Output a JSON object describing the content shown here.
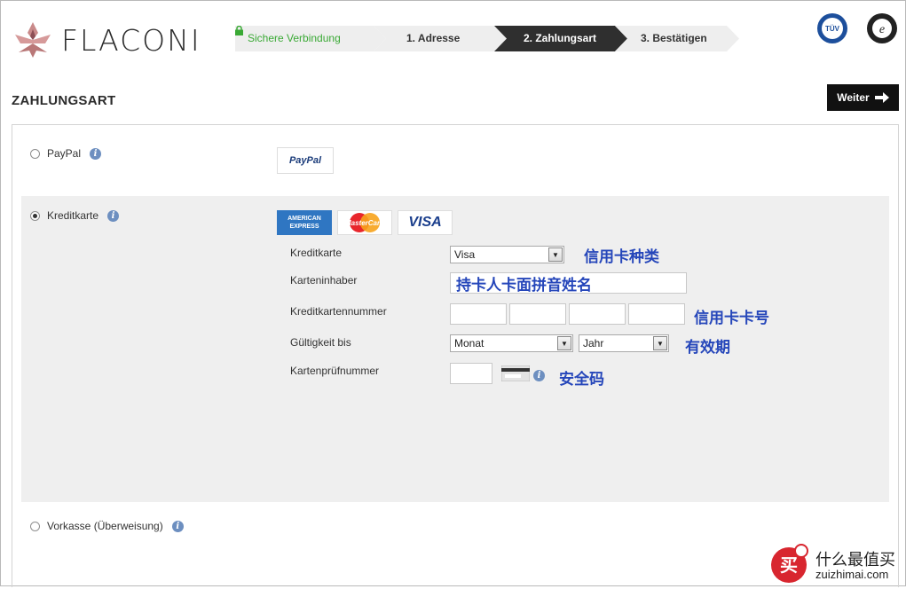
{
  "header": {
    "brand": "FLACONI",
    "steps": [
      {
        "label": "Sichere Verbindung"
      },
      {
        "label": "1. Adresse"
      },
      {
        "label": "2. Zahlungsart"
      },
      {
        "label": "3. Bestätigen"
      }
    ],
    "badges": [
      "TÜV SÜD",
      "Trusted Shops Guarantee"
    ]
  },
  "page": {
    "title": "ZAHLUNGSART",
    "next_button": "Weiter"
  },
  "payment_options": [
    {
      "label": "PayPal",
      "selected": false,
      "logo": "PayPal"
    },
    {
      "label": "Kreditkarte",
      "selected": true
    },
    {
      "label": "Vorkasse (Überweisung)",
      "selected": false
    }
  ],
  "card_logos": [
    "AMERICAN EXPRESS",
    "MasterCard",
    "VISA"
  ],
  "form": {
    "kreditkarte_label": "Kreditkarte",
    "kreditkarte_value": "Visa",
    "inhaber_label": "Karteninhaber",
    "inhaber_value": "持卡人卡面拼音姓名",
    "nummer_label": "Kreditkartennummer",
    "gueltig_label": "Gültigkeit bis",
    "monat_value": "Monat",
    "jahr_value": "Jahr",
    "pruef_label": "Kartenprüfnummer"
  },
  "annotations": {
    "card_type": "信用卡种类",
    "card_number": "信用卡卡号",
    "expiry": "有效期",
    "cvv": "安全码"
  },
  "watermark": {
    "title": "什么最值买",
    "url": "zuizhimai.com"
  },
  "colors": {
    "secure_green": "#3aa935",
    "active_step": "#2f2f2f",
    "annotation_blue": "#2546ba",
    "card_panel_bg": "#efefef"
  }
}
